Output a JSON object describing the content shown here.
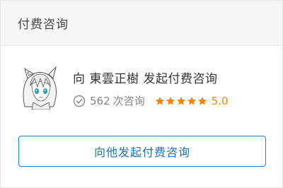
{
  "header": {
    "title": "付费咨询"
  },
  "profile": {
    "prefix": "向",
    "name": "東雲正樹",
    "action": "发起付费咨询",
    "consult_count": "562",
    "consult_unit": "次咨询",
    "rating": "5.0",
    "stars": 5,
    "avatar_icon": "anime-avatar-icon"
  },
  "button": {
    "label": "向他发起付费咨询"
  },
  "colors": {
    "accent_blue": "#1a82d6",
    "star_orange": "#f08519"
  }
}
